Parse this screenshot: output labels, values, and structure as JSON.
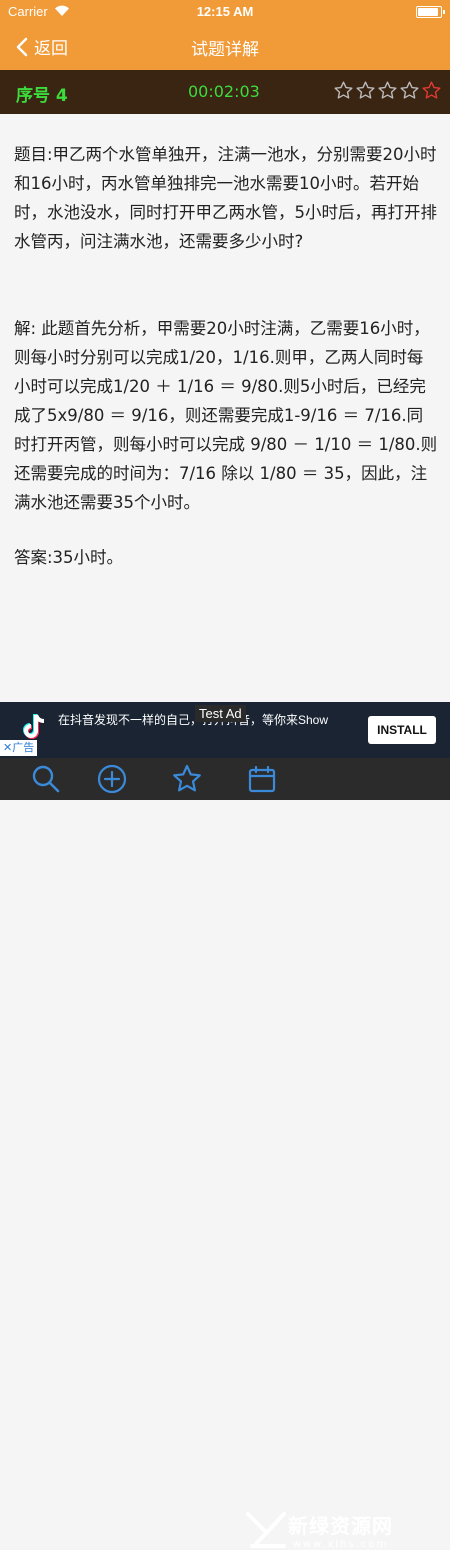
{
  "status_bar": {
    "carrier": "Carrier",
    "time": "12:15 AM"
  },
  "nav": {
    "back_label": "返回",
    "title": "试题详解"
  },
  "info": {
    "sequence": "序号 4",
    "timer": "00:02:03",
    "rating": {
      "max": 5,
      "highlighted_index": 4
    }
  },
  "question": "题目:甲乙两个水管单独开，注满一池水，分别需要20小时和16小时，丙水管单独排完一池水需要10小时。若开始时，水池没水，同时打开甲乙两水管，5小时后，再打开排水管丙，问注满水池，还需要多少小时?",
  "solution": "解: 此题首先分析，甲需要20小时注满，乙需要16小时，则每小时分别可以完成1/20，1/16.则甲，乙两人同时每小时可以完成1/20 ＋ 1/16 ＝ 9/80.则5小时后，已经完成了5x9/80 ＝ 9/16，则还需要完成1-9/16 ＝ 7/16.同时打开丙管，则每小时可以完成 9/80 － 1/10 ＝ 1/80.则还需要完成的时间为：7/16 除以 1/80 ＝ 35，因此，注满水池还需要35个小时。",
  "answer": "答案:35小时。",
  "ad": {
    "tag": "Test Ad",
    "text": "在抖音发现不一样的自己，打开抖音，等你来Show",
    "button": "INSTALL",
    "adchoice_label": "广告"
  },
  "tabs": [
    {
      "icon": "search-icon"
    },
    {
      "icon": "add-icon"
    },
    {
      "icon": "star-icon"
    },
    {
      "icon": "calendar-icon"
    }
  ],
  "watermark": {
    "main": "新绿资源网",
    "sub": "www.xlhs.com"
  },
  "colors": {
    "accent": "#f19a38",
    "info_bg": "#3a2412",
    "info_text": "#3ddc3d",
    "star_highlight": "#e53935",
    "tabbar_bg": "#2b2b2b",
    "icon_blue": "#3b8ad9"
  }
}
